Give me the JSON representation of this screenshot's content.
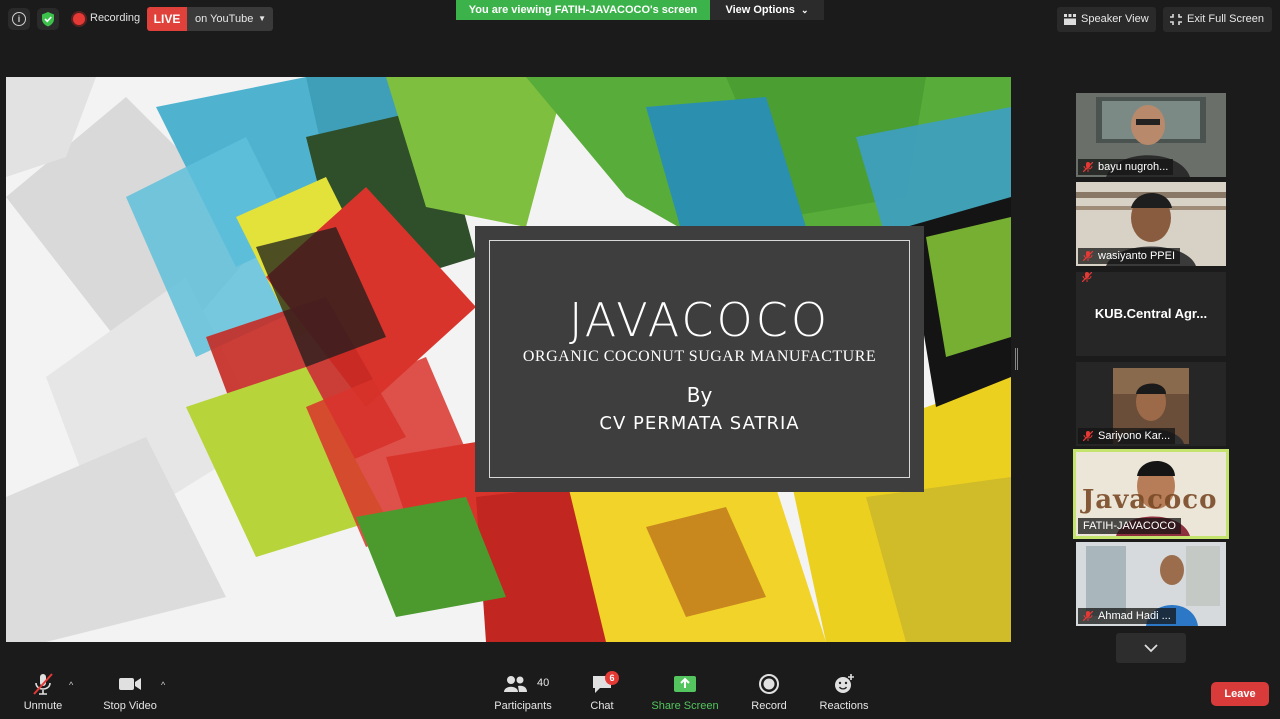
{
  "topbar": {
    "recording_label": "Recording",
    "live_badge": "LIVE",
    "stream_target": "on YouTube",
    "viewing_banner": "You are viewing FATIH-JAVACOCO's screen",
    "view_options": "View Options",
    "speaker_view": "Speaker View",
    "exit_full_screen": "Exit Full Screen",
    "colors": {
      "banner": "#3cb34a",
      "live": "#e0413a"
    }
  },
  "slide": {
    "title": "JAVACOCO",
    "subtitle": "ORGANIC COCONUT SUGAR MANUFACTURE",
    "by": "By",
    "company": "CV PERMATA SATRIA"
  },
  "participants": {
    "tiles": [
      {
        "name": "bayu nugroh...",
        "muted": true,
        "video": true
      },
      {
        "name": "wasiyanto PPEI",
        "muted": true,
        "video": true
      },
      {
        "name": "KUB.Central  Agr...",
        "muted": true,
        "video": false
      },
      {
        "name": "Sariyono Kar...",
        "muted": true,
        "video": true
      },
      {
        "name": "FATIH-JAVACOCO",
        "muted": false,
        "video": true,
        "active_speaker": true,
        "background_text": "Javacoco"
      },
      {
        "name": "Ahmad Hadi ...",
        "muted": true,
        "video": true
      }
    ]
  },
  "toolbar": {
    "unmute": "Unmute",
    "stop_video": "Stop Video",
    "participants": "Participants",
    "participant_count": "40",
    "chat": "Chat",
    "chat_badge": "6",
    "share_screen": "Share Screen",
    "record": "Record",
    "reactions": "Reactions",
    "leave": "Leave",
    "colors": {
      "share": "#53c45e",
      "leave": "#d93b3b"
    }
  }
}
